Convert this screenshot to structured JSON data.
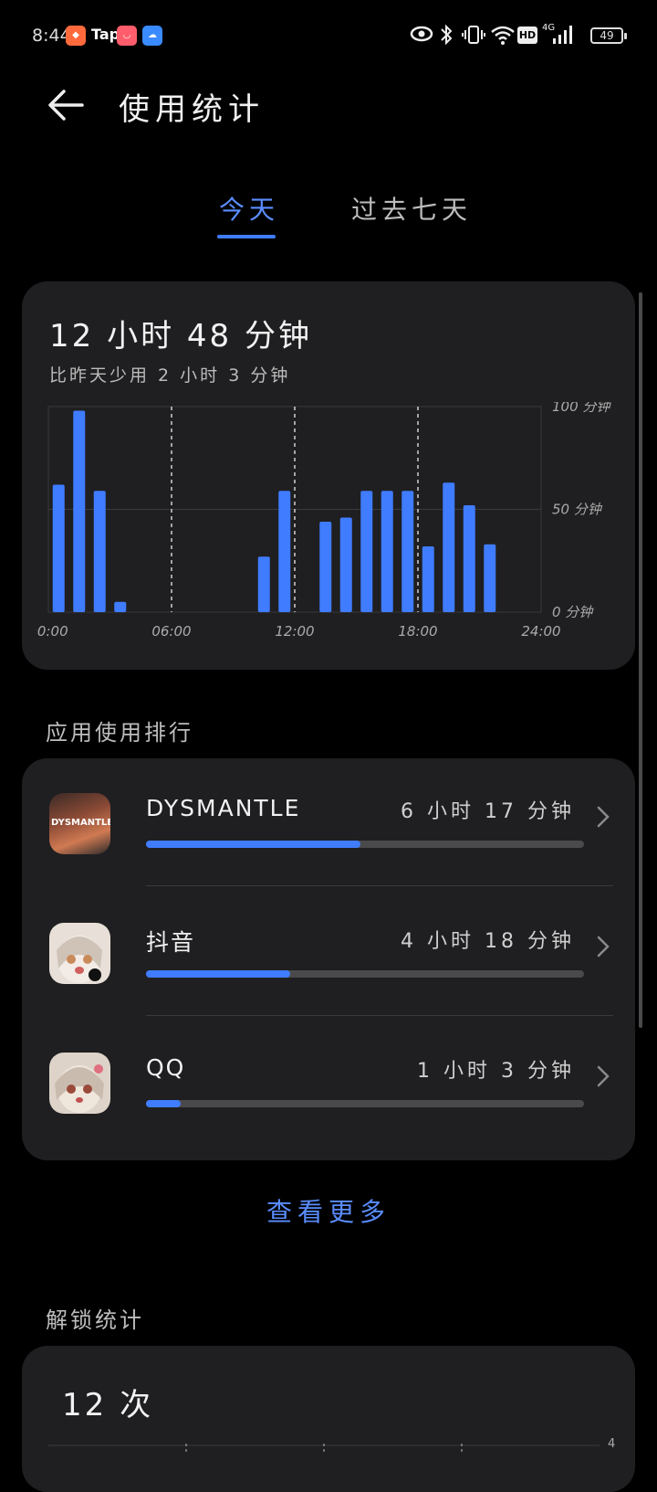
{
  "status_bar": {
    "time": "8:44",
    "apps": [
      {
        "name": "kuaishou-icon",
        "color": "#ff6a3c"
      },
      {
        "name": "taptap-icon",
        "label": "Tap",
        "color": "#00c2cc"
      },
      {
        "name": "redbook-icon",
        "color": "#ff5d6c"
      },
      {
        "name": "cloud-icon",
        "color": "#3a8bff"
      }
    ],
    "battery": "49",
    "network": "4G",
    "hd": "HD"
  },
  "header": {
    "title": "使用统计"
  },
  "tabs": [
    {
      "label": "今天",
      "active": true
    },
    {
      "label": "过去七天",
      "active": false
    }
  ],
  "summary": {
    "total": "12 小时 48 分钟",
    "compare": "比昨天少用 2 小时 3 分钟"
  },
  "chart_data": {
    "type": "bar",
    "x_ticks": [
      "00:00",
      "06:00",
      "12:00",
      "18:00",
      "24:00"
    ],
    "y_ticks": [
      "100 分钟",
      "50 分钟",
      "0 分钟"
    ],
    "ylim": [
      0,
      100
    ],
    "unit": "分钟",
    "bar_color": "#3f7cff",
    "hours": [
      0,
      1,
      2,
      3,
      4,
      5,
      6,
      7,
      8,
      9,
      10,
      11,
      12,
      13,
      14,
      15,
      16,
      17,
      18,
      19,
      20,
      21,
      22,
      23
    ],
    "values": [
      62,
      98,
      59,
      5,
      0,
      0,
      0,
      0,
      0,
      0,
      27,
      59,
      0,
      44,
      46,
      59,
      59,
      59,
      32,
      63,
      52,
      33,
      0,
      0
    ]
  },
  "ranking": {
    "label": "应用使用排行",
    "apps": [
      {
        "name": "DYSMANTLE",
        "duration": "6 小时 17 分钟",
        "fraction": 0.49,
        "icon": "dysmantle-icon",
        "icon_text": "DYSMANTLE"
      },
      {
        "name": "抖音",
        "duration": "4 小时 18 分钟",
        "fraction": 0.33,
        "icon": "douyin-icon"
      },
      {
        "name": "QQ",
        "duration": "1 小时 3 分钟",
        "fraction": 0.08,
        "icon": "qq-icon"
      }
    ]
  },
  "more_link": "查看更多",
  "unlock": {
    "label": "解锁统计",
    "count": "12 次",
    "y_tick": "4"
  }
}
